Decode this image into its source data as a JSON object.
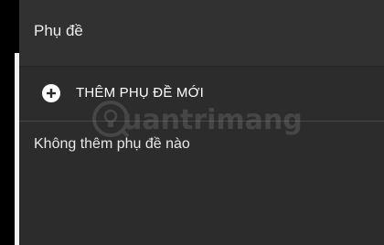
{
  "panel": {
    "title": "Phụ đề",
    "add_subtitle_label": "THÊM PHỤ ĐỀ MỚI",
    "empty_message": "Không thêm phụ đề nào"
  },
  "icons": {
    "add": "plus-circle-icon"
  },
  "watermark": {
    "text": "uantrimang"
  },
  "colors": {
    "panel_bg": "#2c2c2c",
    "header_bg": "#313131",
    "text": "#eeeeee",
    "divider": "#474747"
  }
}
